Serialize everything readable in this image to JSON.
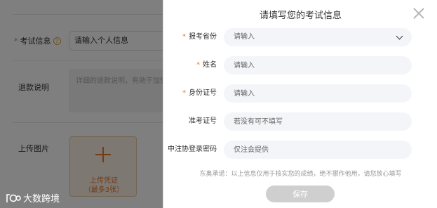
{
  "background_form": {
    "exam_info_label": "考试信息",
    "exam_info_value": "请输入个人信息",
    "refund_label": "退款说明",
    "refund_placeholder": "详细的退款说明，有助于加快审核",
    "upload_label": "上传图片",
    "upload_button_line1": "上传凭证",
    "upload_button_line2": "（最多3张）"
  },
  "watermark": {
    "text": "大数跨境"
  },
  "modal": {
    "title": "请填写您的考试信息",
    "fields": [
      {
        "label": "报考省份",
        "required": true,
        "placeholder": "请输入",
        "type": "select"
      },
      {
        "label": "姓名",
        "required": true,
        "placeholder": "请输入",
        "type": "text"
      },
      {
        "label": "身份证号",
        "required": true,
        "placeholder": "请输入",
        "type": "text"
      },
      {
        "label": "准考证号",
        "required": false,
        "placeholder": "若没有可不填写",
        "type": "text"
      },
      {
        "label": "中注协登录密码",
        "required": false,
        "placeholder": "仅注会提供",
        "type": "text"
      }
    ],
    "promise_text": "东奥承诺：以上信息仅用于核实您的成绩，绝不挪作他用，请您放心填写",
    "save_label": "保存"
  },
  "colors": {
    "accent": "#e8762c",
    "field_bg": "#f4f5f9",
    "save_disabled": "#cfcfcf"
  }
}
